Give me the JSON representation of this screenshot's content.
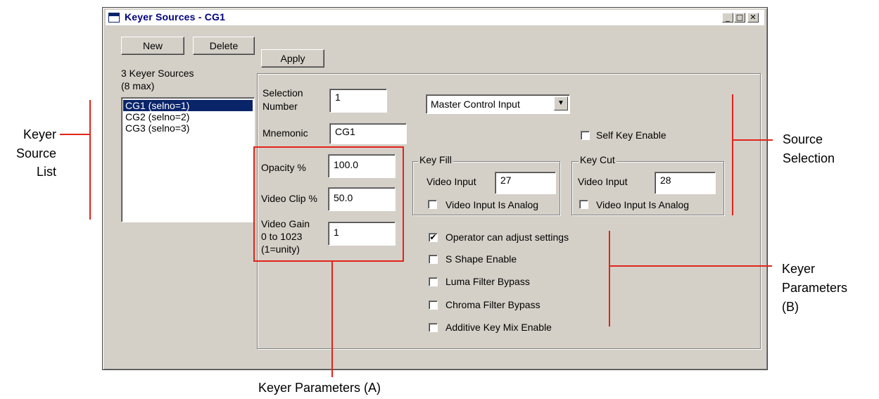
{
  "window": {
    "title": "Keyer Sources - CG1",
    "controls": [
      "_",
      "□",
      "✕"
    ]
  },
  "left": {
    "new_label": "New",
    "delete_label": "Delete",
    "count_label": "3 Keyer Sources",
    "max_label": "(8 max)",
    "items": [
      {
        "label": "CG1 (selno=1)",
        "selected": true
      },
      {
        "label": "CG2 (selno=2)",
        "selected": false
      },
      {
        "label": "CG3 (selno=3)",
        "selected": false
      }
    ]
  },
  "apply_label": "Apply",
  "form": {
    "selection_label_1": "Selection",
    "selection_label_2": "Number",
    "selection_value": "1",
    "mnemonic_label": "Mnemonic",
    "mnemonic_value": "CG1",
    "source_select": "Master Control Input",
    "self_key_label": "Self Key Enable",
    "self_key_checked": false,
    "opacity_label": "Opacity %",
    "opacity_value": "100.0",
    "clip_label": "Video Clip %",
    "clip_value": "50.0",
    "gain_label_1": "Video Gain",
    "gain_label_2": "0 to 1023",
    "gain_label_3": "(1=unity)",
    "gain_value": "1",
    "key_fill": {
      "title": "Key Fill",
      "video_input_label": "Video Input",
      "video_input_value": "27",
      "analog_label": "Video Input Is Analog",
      "analog_checked": false
    },
    "key_cut": {
      "title": "Key Cut",
      "video_input_label": "Video Input",
      "video_input_value": "28",
      "analog_label": "Video Input Is Analog",
      "analog_checked": false
    },
    "options": [
      {
        "label": "Operator can adjust settings",
        "checked": true
      },
      {
        "label": "S Shape Enable",
        "checked": false
      },
      {
        "label": "Luma Filter Bypass",
        "checked": false
      },
      {
        "label": "Chroma Filter Bypass",
        "checked": false
      },
      {
        "label": "Additive Key Mix Enable",
        "checked": false
      }
    ]
  },
  "callouts": {
    "source_list_1": "Keyer",
    "source_list_2": "Source",
    "source_list_3": "List",
    "source_selection_1": "Source",
    "source_selection_2": "Selection",
    "params_b_1": "Keyer",
    "params_b_2": "Parameters",
    "params_b_3": "(B)",
    "params_a": "Keyer Parameters (A)"
  },
  "colors": {
    "accent_red": "#e2231a",
    "selection_blue": "#0a246a",
    "dialog_gray": "#d4d0c8"
  }
}
